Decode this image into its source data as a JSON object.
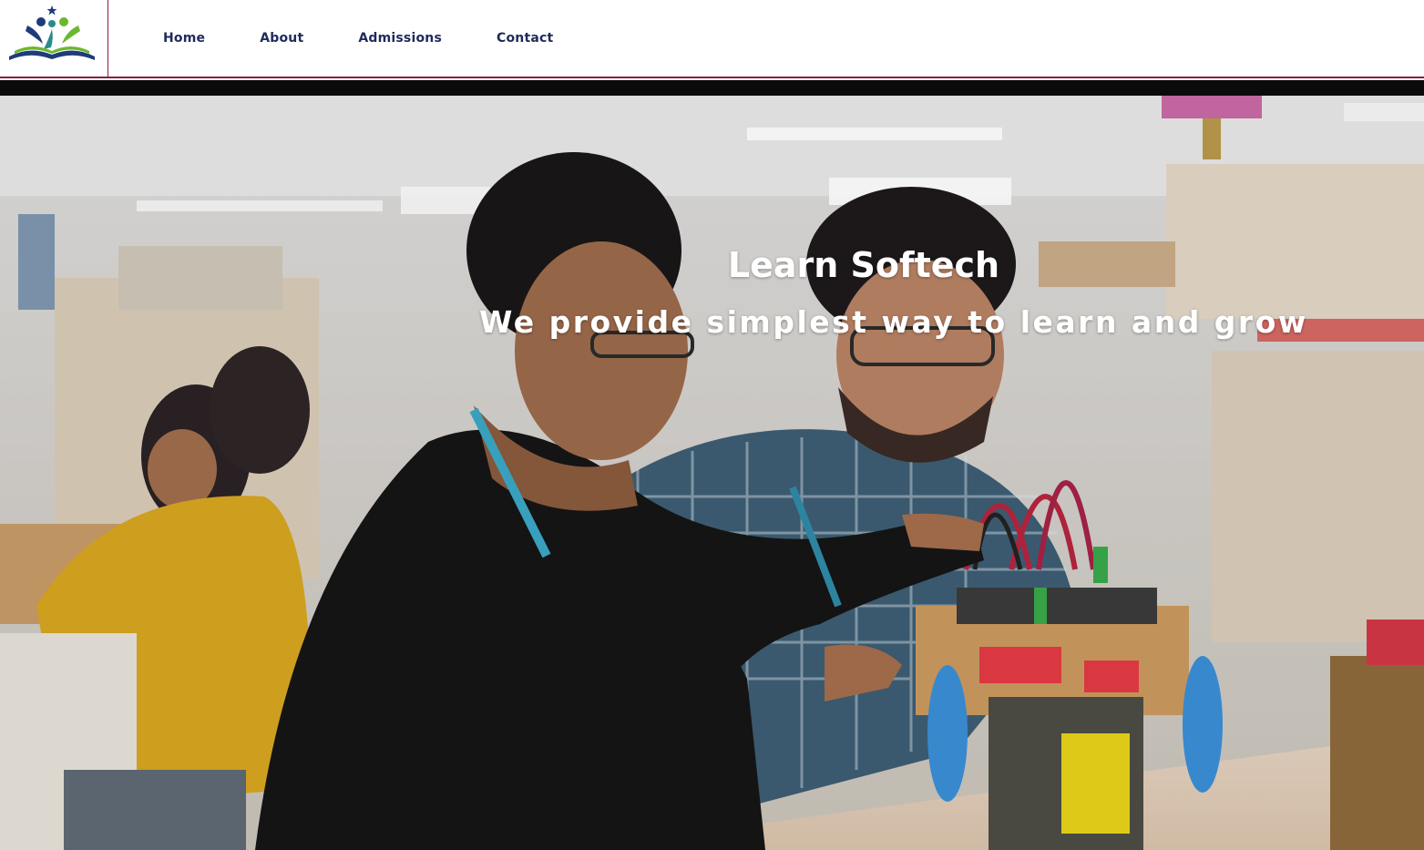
{
  "nav": {
    "logo": "open-book-students-logo",
    "links": [
      {
        "label": "Home"
      },
      {
        "label": "About"
      },
      {
        "label": "Admissions"
      },
      {
        "label": "Contact"
      }
    ]
  },
  "hero": {
    "title": "Learn Softech",
    "subtitle": "We provide simplest way to learn and grow",
    "background": "students-in-electronics-lab-photo"
  },
  "colors": {
    "nav_text": "#1f2a5c",
    "nav_border": "#8a1f3c",
    "band": "#0b0b0b",
    "hero_text": "#ffffff"
  }
}
